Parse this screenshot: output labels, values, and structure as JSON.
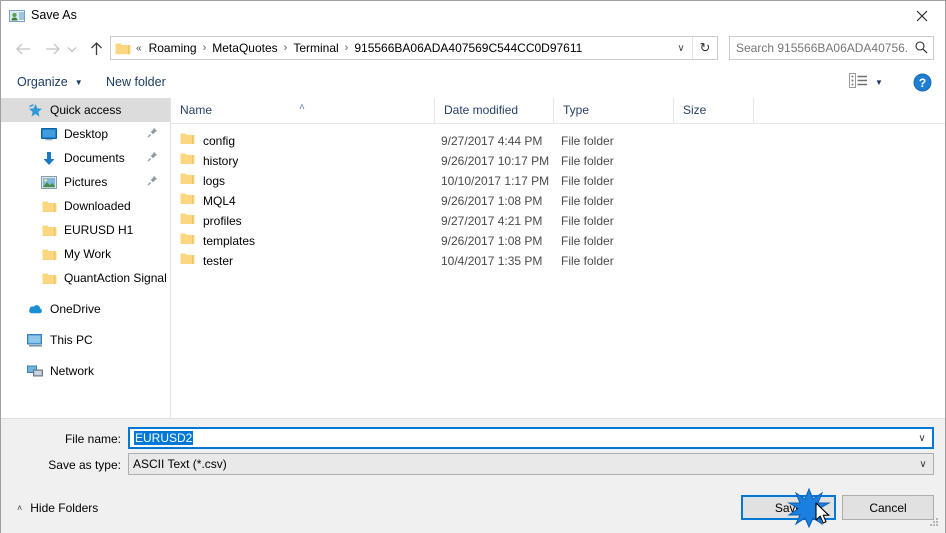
{
  "window": {
    "title": "Save As",
    "icon": "save-as-app-icon",
    "close_label": "✕"
  },
  "navbar": {
    "back_icon": "←",
    "forward_icon": "→",
    "history_icon": "⌄",
    "up_icon": "↑",
    "folder_icon": "folder-icon",
    "path_prefix": "«",
    "crumbs": [
      "Roaming",
      "MetaQuotes",
      "Terminal",
      "915566BA06ADA407569C544CC0D97611"
    ],
    "separator": "›",
    "dropdown_icon": "∨",
    "refresh_icon": "↻",
    "search_placeholder": "Search 915566BA06ADA40756...",
    "search_icon": "⚲"
  },
  "commandbar": {
    "organize_label": "Organize",
    "organize_caret": "▼",
    "new_folder_label": "New folder",
    "view_icon": "list-view-icon",
    "view_caret": "▼",
    "help_icon": "help-icon"
  },
  "sidebar": {
    "items": [
      {
        "label": "Quick access",
        "icon": "star-icon",
        "level": 0,
        "selected": true,
        "pin": false
      },
      {
        "label": "Desktop",
        "icon": "desktop-icon",
        "level": 1,
        "selected": false,
        "pin": true
      },
      {
        "label": "Documents",
        "icon": "download-arrow-icon",
        "level": 1,
        "selected": false,
        "pin": true
      },
      {
        "label": "Pictures",
        "icon": "pictures-icon",
        "level": 1,
        "selected": false,
        "pin": true
      },
      {
        "label": "Downloaded",
        "icon": "folder-icon",
        "level": 1,
        "selected": false,
        "pin": false
      },
      {
        "label": "EURUSD H1",
        "icon": "folder-icon",
        "level": 1,
        "selected": false,
        "pin": false
      },
      {
        "label": "My Work",
        "icon": "folder-icon",
        "level": 1,
        "selected": false,
        "pin": false
      },
      {
        "label": "QuantAction Signal",
        "icon": "folder-icon",
        "level": 1,
        "selected": false,
        "pin": false
      },
      {
        "label": "",
        "icon": "spacer",
        "level": 0,
        "selected": false,
        "pin": false
      },
      {
        "label": "OneDrive",
        "icon": "onedrive-icon",
        "level": 0,
        "selected": false,
        "pin": false
      },
      {
        "label": "",
        "icon": "spacer",
        "level": 0,
        "selected": false,
        "pin": false
      },
      {
        "label": "This PC",
        "icon": "this-pc-icon",
        "level": 0,
        "selected": false,
        "pin": false
      },
      {
        "label": "",
        "icon": "spacer",
        "level": 0,
        "selected": false,
        "pin": false
      },
      {
        "label": "Network",
        "icon": "network-icon",
        "level": 0,
        "selected": false,
        "pin": false
      }
    ]
  },
  "filelist": {
    "columns": [
      "Name",
      "Date modified",
      "Type",
      "Size"
    ],
    "sort_indicator": "˄",
    "rows": [
      {
        "name": "config",
        "date": "9/27/2017 4:44 PM",
        "type": "File folder",
        "size": ""
      },
      {
        "name": "history",
        "date": "9/26/2017 10:17 PM",
        "type": "File folder",
        "size": ""
      },
      {
        "name": "logs",
        "date": "10/10/2017 1:17 PM",
        "type": "File folder",
        "size": ""
      },
      {
        "name": "MQL4",
        "date": "9/26/2017 1:08 PM",
        "type": "File folder",
        "size": ""
      },
      {
        "name": "profiles",
        "date": "9/27/2017 4:21 PM",
        "type": "File folder",
        "size": ""
      },
      {
        "name": "templates",
        "date": "9/26/2017 1:08 PM",
        "type": "File folder",
        "size": ""
      },
      {
        "name": "tester",
        "date": "10/4/2017 1:35 PM",
        "type": "File folder",
        "size": ""
      }
    ]
  },
  "form": {
    "filename_label": "File name:",
    "filename_value": "EURUSD2",
    "filename_selected": true,
    "savetype_label": "Save as type:",
    "savetype_value": "ASCII Text (*.csv)",
    "dropdown_icon": "∨"
  },
  "footer": {
    "hide_folders_label": "Hide Folders",
    "hide_folders_caret": "˄",
    "save_label": "Save",
    "cancel_label": "Cancel"
  },
  "colors": {
    "accent": "#0078d7",
    "header_text": "#27406b",
    "folder_yellow": "#fbd46d",
    "panel_bg": "#f0f0f0"
  }
}
